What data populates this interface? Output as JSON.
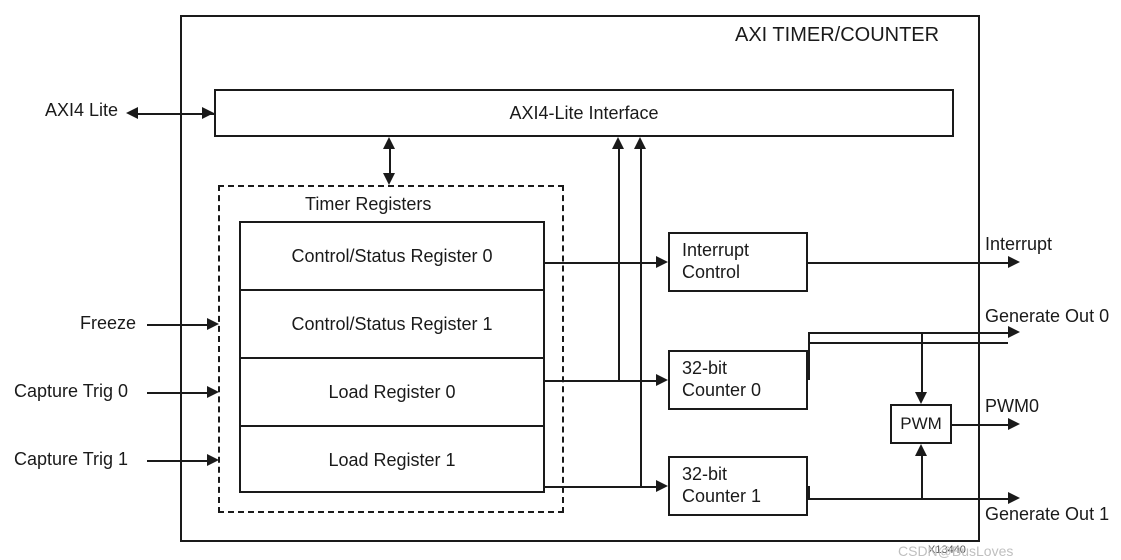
{
  "title": "AXI TIMER/COUNTER",
  "axi4_lite_ext": "AXI4 Lite",
  "axi4_lite_interface": "AXI4-Lite Interface",
  "timer_registers_title": "Timer Registers",
  "registers": {
    "csr0": "Control/Status Register 0",
    "csr1": "Control/Status Register 1",
    "lr0": "Load Register 0",
    "lr1": "Load Register 1"
  },
  "inputs": {
    "freeze": "Freeze",
    "cap0": "Capture Trig 0",
    "cap1": "Capture Trig 1"
  },
  "blocks": {
    "interrupt_control": "Interrupt\nControl",
    "counter0": "32-bit\nCounter 0",
    "counter1": "32-bit\nCounter 1",
    "pwm": "PWM"
  },
  "outputs": {
    "interrupt": "Interrupt",
    "gen0": "Generate Out 0",
    "gen1": "Generate Out 1",
    "pwm0": "PWM0"
  },
  "fig_id": "X13440",
  "watermark": "CSDN@BusLoves"
}
